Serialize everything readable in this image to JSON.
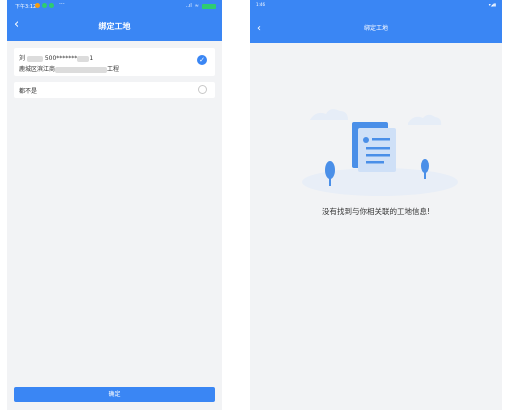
{
  "left": {
    "status": {
      "time": "下午3:12",
      "ellipsis": "···",
      "signal": "..ıl",
      "wifi": "≈"
    },
    "nav": {
      "back": "‹",
      "title": "绑定工地"
    },
    "site_item": {
      "name_prefix": "刘",
      "phone_prefix": "500*******",
      "phone_suffix": "1",
      "address_prefix": "鹿城区滨江商",
      "address_suffix": "工程",
      "selected": true
    },
    "none_item": {
      "label": "都不是",
      "selected": false
    },
    "confirm_button": "确定",
    "colors": {
      "accent": "#3a86f4"
    }
  },
  "right": {
    "status": {
      "time": "1:46",
      "icons": "▾◢▮"
    },
    "nav": {
      "back": "‹",
      "title": "绑定工地"
    },
    "empty_message": "没有找到与你相关联的工地信息!",
    "illustration": "document-with-clouds-and-trees"
  }
}
